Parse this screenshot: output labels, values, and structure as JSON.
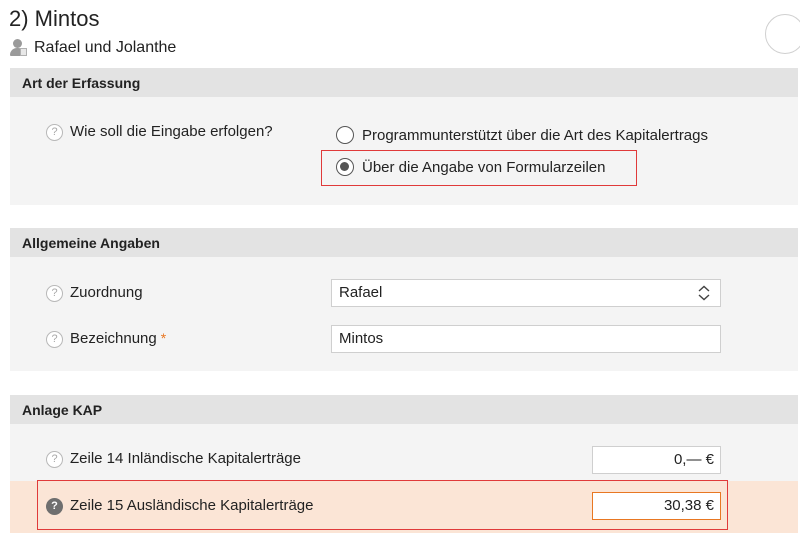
{
  "header": {
    "title": "2) Mintos",
    "person_name": "Rafael und Jolanthe"
  },
  "sections": {
    "erfassung": {
      "title": "Art der Erfassung",
      "question": "Wie soll die Eingabe erfolgen?",
      "options": [
        {
          "label": "Programmunterstützt über die Art des Kapitalertrags",
          "selected": false
        },
        {
          "label": "Über die Angabe von Formularzeilen",
          "selected": true
        }
      ]
    },
    "allgemein": {
      "title": "Allgemeine Angaben",
      "zuordnung_label": "Zuordnung",
      "zuordnung_value": "Rafael",
      "bezeichnung_label": "Bezeichnung",
      "bezeichnung_required": "*",
      "bezeichnung_value": "Mintos"
    },
    "kap": {
      "title": "Anlage KAP",
      "zeile14_label": "Zeile 14 Inländische Kapitalerträge",
      "zeile14_value": "0,— €",
      "zeile15_label": "Zeile 15 Ausländische Kapitalerträge",
      "zeile15_value": "30,38 €"
    }
  },
  "help_glyph": "?",
  "colors": {
    "accent_orange": "#e87722",
    "annotation_red": "#e03a3a",
    "highlight_row": "#fbe5d6"
  }
}
